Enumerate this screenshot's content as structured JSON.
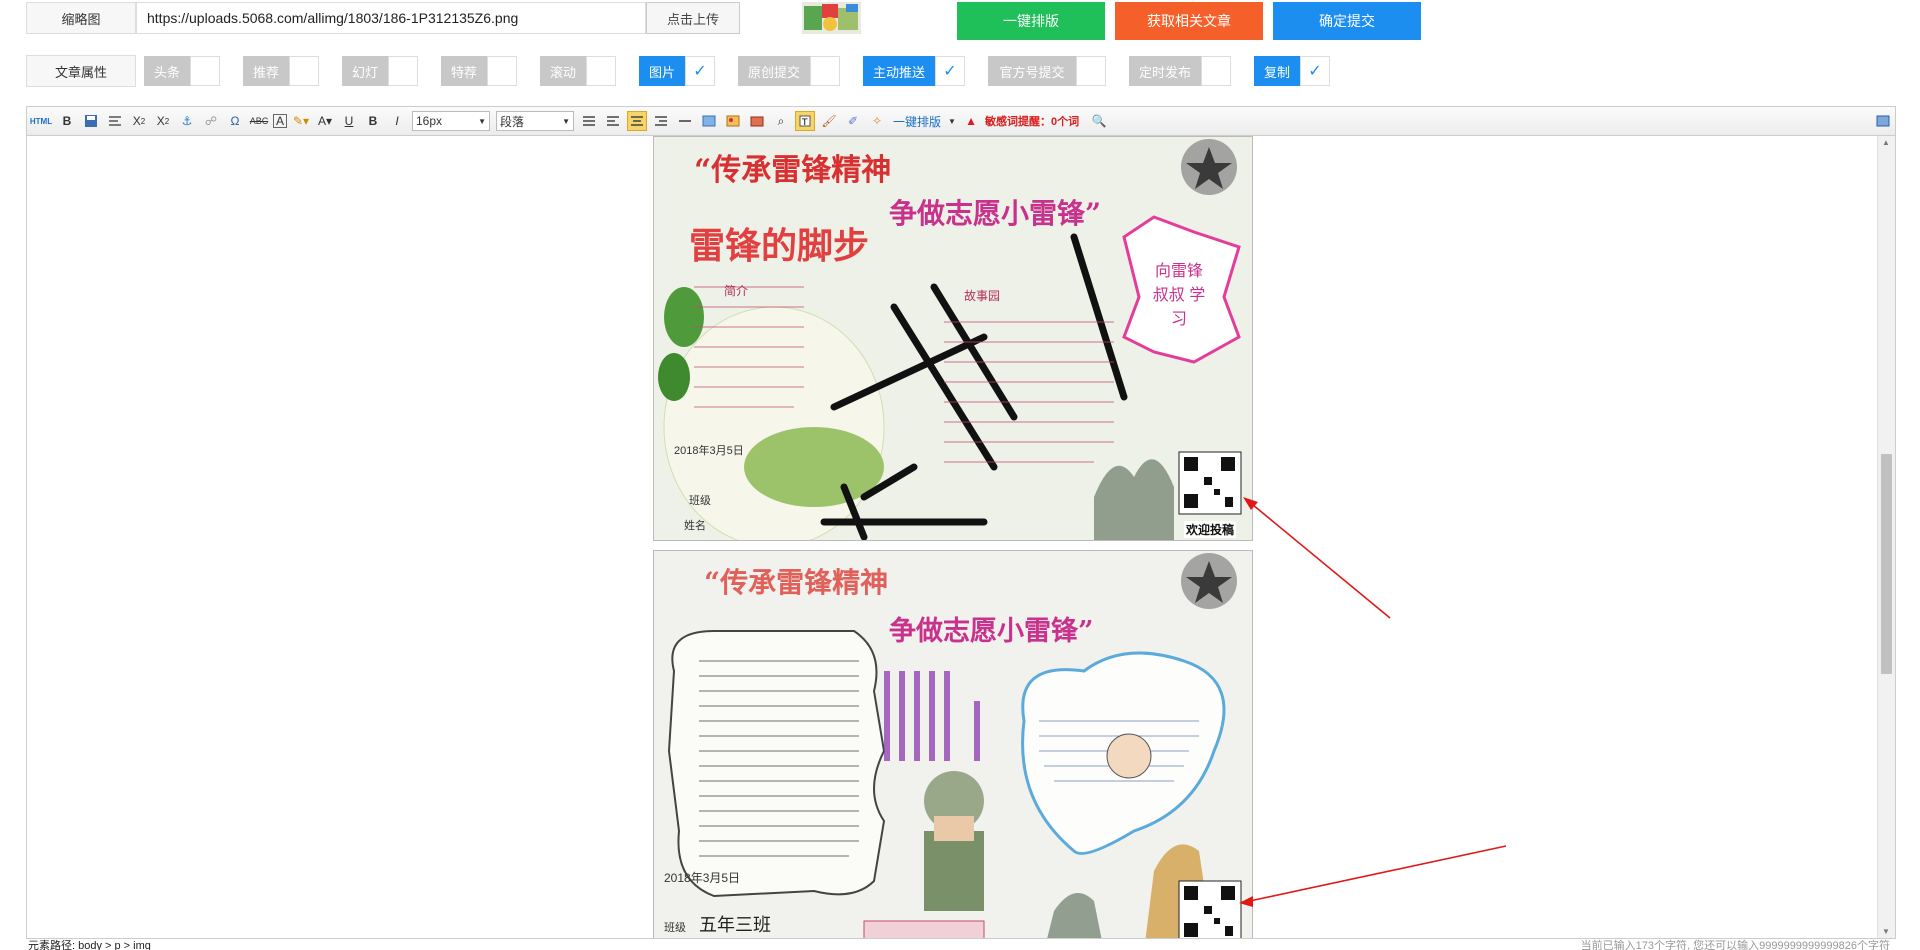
{
  "thumbnail": {
    "label": "缩略图",
    "url": "https://uploads.5068.com/allimg/1803/186-1P312135Z6.png",
    "upload_button": "点击上传"
  },
  "actions": {
    "auto_format": "一键排版",
    "fetch_articles": "获取相关文章",
    "confirm_submit": "确定提交",
    "colors": {
      "green": "#1fbf5a",
      "orange": "#f5602a",
      "blue": "#1b8ef0"
    }
  },
  "properties": {
    "label": "文章属性",
    "items": [
      {
        "label": "头条",
        "checked": false
      },
      {
        "label": "推荐",
        "checked": false
      },
      {
        "label": "幻灯",
        "checked": false
      },
      {
        "label": "特荐",
        "checked": false
      },
      {
        "label": "滚动",
        "checked": false
      },
      {
        "label": "图片",
        "checked": true
      },
      {
        "label": "原创提交",
        "checked": false
      },
      {
        "label": "主动推送",
        "checked": true
      },
      {
        "label": "官方号提交",
        "checked": false
      },
      {
        "label": "定时发布",
        "checked": false
      },
      {
        "label": "复制",
        "checked": true
      }
    ],
    "colors": {
      "inactive": "#c8c8c8",
      "active": "#1b8ef0"
    }
  },
  "toolbar": {
    "html_label": "HTML",
    "font_size": "16px",
    "paragraph": "段落",
    "auto_format": "一键排版",
    "sensitive_words": "敏感词提醒：0个词"
  },
  "content": {
    "poster1": {
      "title_line1": "“传承雷锋精神",
      "title_line2": "争做志愿小雷锋”",
      "subtitle": "雷锋的脚步",
      "story_title": "故事园",
      "side_title": "向雷锋 叔叔 学习",
      "intro_title": "简介",
      "date": "2018年3月5日",
      "class_label": "班级",
      "name_label": "姓名",
      "qr_caption": "欢迎投稿"
    },
    "poster2": {
      "title_line1": "“传承雷锋精神",
      "title_line2": "争做志愿小雷锋”",
      "date": "2018年3月5日",
      "class_label": "班级",
      "class_value": "五年三班"
    }
  },
  "statusbar": {
    "path": "元素路径: body > p > img",
    "count": "当前已输入173个字符, 您还可以输入9999999999999826个字符"
  }
}
